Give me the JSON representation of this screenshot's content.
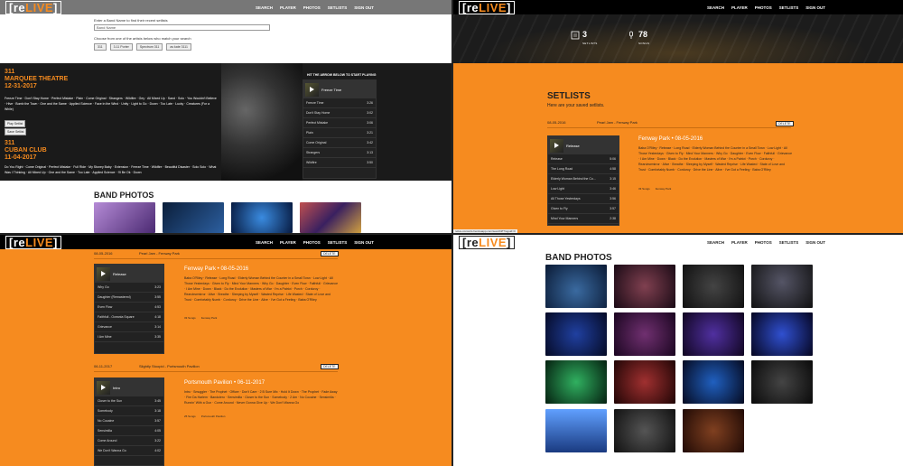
{
  "app": {
    "logo_re": "re",
    "logo_live": "LIVE"
  },
  "nav": {
    "search": "SEARCH",
    "player": "PLAYER",
    "photos": "PHOTOS",
    "setlists": "SETLISTS",
    "signout": "SIGN OUT"
  },
  "q1": {
    "prompt": "Enter a Band Name to find their recent setlists",
    "placeholder": "Band Name",
    "choose": "Choose from one of the artists below who match your search",
    "artists": [
      "311",
      "3-11 Porter",
      "Spectrum 311",
      "as kate 3111"
    ],
    "c1_band": "311",
    "c1_venue": "MARQUEE THEATRE",
    "c1_date": "12-31-2017",
    "c1_songs": "Freeze Time · Don't Stay Home · Perfect Mistake · Plain · Come Original · Strangers · Wildfire · Gey · All Mixed Up · Sand · Solo · You Wouldn't Believe · Hive · Bomb the Town · One and the Same · Applied Science · Face in the Wind · Unity · Light to Go · Down · Too Late · Lucky · Creatures (For a While)",
    "hint": "HIT THE ARROW BELOW TO START PLAYING",
    "player_title": "Freeze Time",
    "player_songs": [
      [
        "Freeze Time",
        "3:26"
      ],
      [
        "Don't Stay Home",
        "3:02"
      ],
      [
        "Perfect Mistake",
        "3:06"
      ],
      [
        "Plain",
        "3:21"
      ],
      [
        "Come Original",
        "3:42"
      ],
      [
        "Strangers",
        "3:13"
      ],
      [
        "Wildfire",
        "3:50"
      ]
    ],
    "play": "Play Setlist",
    "save": "Save Setlist",
    "c2_band": "311",
    "c2_venue": "CUBAN CLUB",
    "c2_date": "11-04-2017",
    "c2_sub": "Ybor City",
    "c2_songs": "Do You Right · Come Original · Perfect Mistake · Full Ride · My Stoney Baby · Extension · Freeze Time · Wildfire · Beautiful Disaster · Solo Solo · What Was I Thinking · All Mixed Up · One and the Same · Too Late · Applied Science · I'll Be Ok · Down",
    "photos_title": "BAND PHOTOS"
  },
  "q2": {
    "setlists_count": "3",
    "setlists_label": "SETLISTS",
    "songs_count": "78",
    "songs_label": "SONGS",
    "title": "SETLISTS",
    "subtitle": "Here are your saved setlists.",
    "row_date": "08-05-2016",
    "row_name": "Pearl Jam - Fenway Park",
    "delete": "DELETE",
    "card_title": "Fenway Park • 08-05-2016",
    "card_songs": "Baba O'Riley · Release · Long Road · Elderly Woman Behind the Counter in a Small Town · Low Light · All Those Yesterdays · Given to Fly · Mind Your Manners · Why Go · Daughter · Even Flow · Faithfull · Grievance · I Am Mine · Down · Black · Do the Evolution · Masters of War · I'm a Patriot · Porch · Corduroy · Rearviewmirror · Alive · Breathe · Sleeping by Myself · Wasted Reprise · Life Wasted · State of Love and Trust · Comfortably Numb · Corduroy · Drive the Line · Alive · I've Got a Feeling · Baba O'Riley",
    "meta_songs": "33 Songs",
    "meta_venue": "Fenway Park",
    "player_title": "Release",
    "player_songs": [
      [
        "Release",
        "5:06"
      ],
      [
        "The Long Road",
        "4:58"
      ],
      [
        "Elderly Woman Behind the Co...",
        "3:15"
      ],
      [
        "Low Light",
        "3:46"
      ],
      [
        "All Those Yesterdays",
        "3:56"
      ],
      [
        "Given to Fly",
        "3:57"
      ],
      [
        "Mind Your Manners",
        "2:38"
      ]
    ],
    "url": "relive-concerts.herokuapp.com/search#!?rsguid=0"
  },
  "q3": {
    "row1_date": "08-05-2016",
    "row1_name": "Pearl Jam - Fenway Park",
    "delete": "DELETE",
    "card1_title": "Fenway Park • 08-05-2016",
    "card1_songs": "Baba O'Riley · Release · Long Road · Elderly Woman Behind the Counter in a Small Town · Low Light · All Those Yesterdays · Given to Fly · Mind Your Manners · Why Go · Daughter · Even Flow · Faithfull · Grievance · I Am Mine · Down · Black · Do the Evolution · Masters of War · I'm a Patriot · Porch · Corduroy · Rearviewmirror · Alive · Breathe · Sleeping by Myself · Wasted Reprise · Life Wasted · State of Love and Trust · Comfortably Numb · Corduroy · Drive the Line · Alive · I've Got a Feeling · Baba O'Riley",
    "meta1": "33 Songs",
    "meta1b": "Fenway Park",
    "player1": [
      [
        "Release",
        "5:06"
      ],
      [
        "Why Go",
        "3:23"
      ],
      [
        "Daughter (Remastered)",
        "3:55"
      ],
      [
        "Even Flow",
        "4:53"
      ],
      [
        "Faithfull - Oceania Square",
        "4:18"
      ],
      [
        "Grievance",
        "3:14"
      ],
      [
        "I Am Mine",
        "3:35"
      ]
    ],
    "row2_date": "06-11-2017",
    "row2_name": "Slightly Stoopid - Portsmouth Pavilion",
    "card2_title": "Portsmouth Pavilion • 06-11-2017",
    "card2_songs": "Intro · Smuggler · The Prophet · Officer · Don't Care · 2 B Sure Mix · Hold It Down · The Prophet · Fade Away · Fire Da Harlem · Bandolero · Sensimilla · Closer to the Sun · Somebody · 2 Am · No Cocaine · Sensimilla · Runnin' With a Gun · Come Around · Never Gonna Give Up · We Don't Wanna Go",
    "meta2": "25 Songs",
    "meta2b": "Portsmouth Pavilion",
    "player2": [
      [
        "Intro",
        "1:45"
      ],
      [
        "Closer to the Sun",
        "3:45"
      ],
      [
        "Somebody",
        "3:18"
      ],
      [
        "No Cocaine",
        "3:57"
      ],
      [
        "Sensimilla",
        "4:05"
      ],
      [
        "Come Around",
        "3:22"
      ],
      [
        "We Don't Wanna Go",
        "4:02"
      ]
    ]
  },
  "q4": {
    "title": "BAND PHOTOS"
  }
}
